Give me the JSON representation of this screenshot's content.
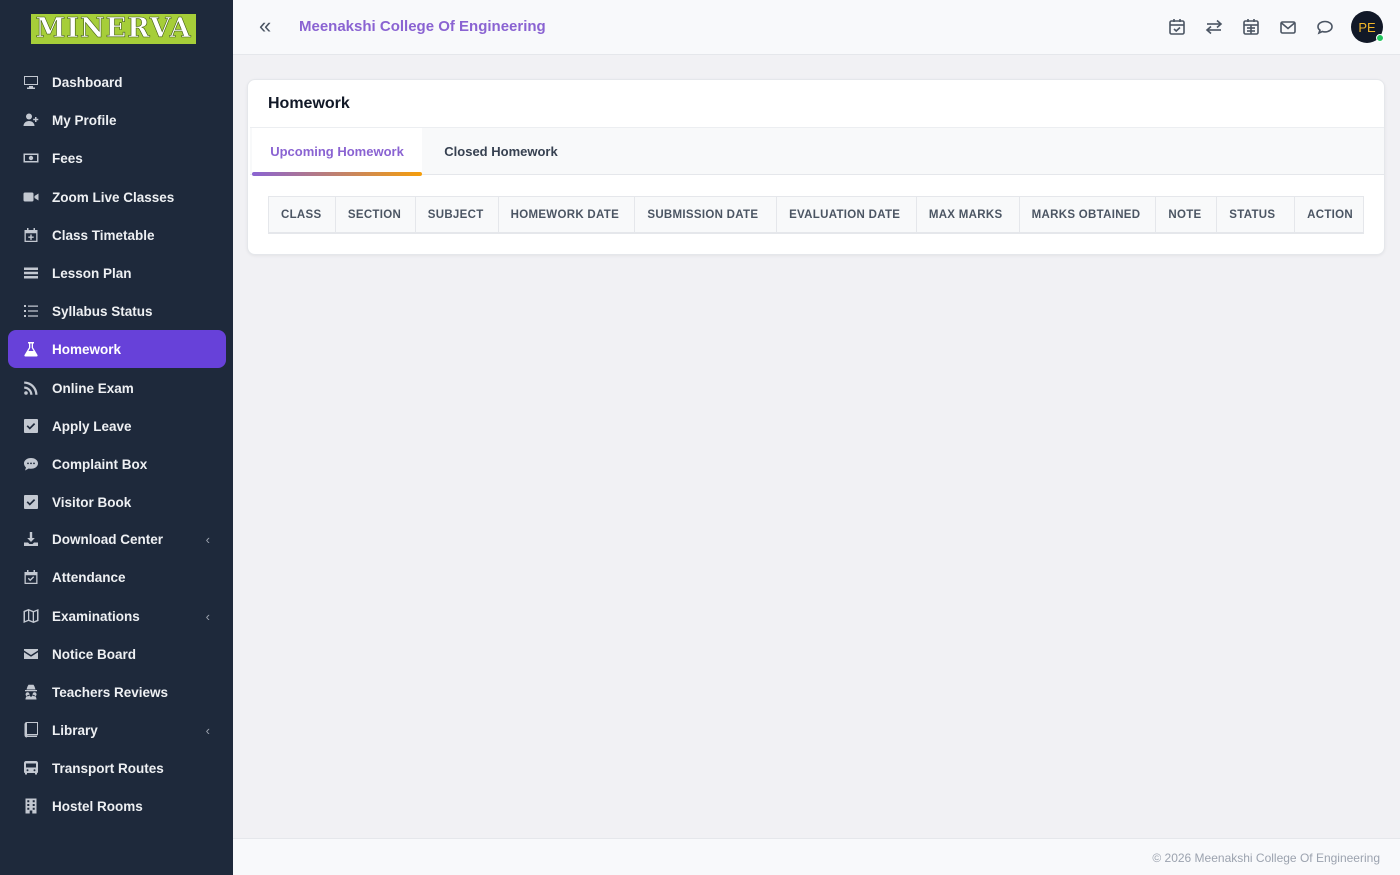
{
  "brand": {
    "logo_text": "MINERVA",
    "logo_color": "#a6ce39"
  },
  "header": {
    "college_name": "Meenakshi College Of Engineering",
    "avatar_initials": "PE",
    "accent": "#8a63d2"
  },
  "sidebar": {
    "items": [
      {
        "label": "Dashboard",
        "icon": "monitor-icon"
      },
      {
        "label": "My Profile",
        "icon": "user-plus-icon"
      },
      {
        "label": "Fees",
        "icon": "money-icon"
      },
      {
        "label": "Zoom Live Classes",
        "icon": "video-icon"
      },
      {
        "label": "Class Timetable",
        "icon": "calendar-plus-icon"
      },
      {
        "label": "Lesson Plan",
        "icon": "list-icon"
      },
      {
        "label": "Syllabus Status",
        "icon": "list-ol-icon"
      },
      {
        "label": "Homework",
        "icon": "flask-icon",
        "active": true
      },
      {
        "label": "Online Exam",
        "icon": "rss-icon"
      },
      {
        "label": "Apply Leave",
        "icon": "check-square-icon"
      },
      {
        "label": "Complaint Box",
        "icon": "comment-icon"
      },
      {
        "label": "Visitor Book",
        "icon": "check-square-icon"
      },
      {
        "label": "Download Center",
        "icon": "download-icon",
        "submenu": true
      },
      {
        "label": "Attendance",
        "icon": "calendar-check-icon"
      },
      {
        "label": "Examinations",
        "icon": "map-icon",
        "submenu": true
      },
      {
        "label": "Notice Board",
        "icon": "envelope-icon"
      },
      {
        "label": "Teachers Reviews",
        "icon": "user-secret-icon"
      },
      {
        "label": "Library",
        "icon": "book-icon",
        "submenu": true
      },
      {
        "label": "Transport Routes",
        "icon": "bus-icon"
      },
      {
        "label": "Hostel Rooms",
        "icon": "building-icon"
      }
    ],
    "active_color": "#6741d9"
  },
  "card": {
    "title": "Homework",
    "tabs": [
      {
        "label": "Upcoming Homework",
        "active": true
      },
      {
        "label": "Closed Homework",
        "active": false
      }
    ],
    "columns": [
      "CLASS",
      "SECTION",
      "SUBJECT",
      "HOMEWORK DATE",
      "SUBMISSION DATE",
      "EVALUATION DATE",
      "MAX MARKS",
      "MARKS OBTAINED",
      "NOTE",
      "STATUS",
      "ACTION"
    ]
  },
  "footer": {
    "text": "© 2026 Meenakshi College Of Engineering"
  }
}
